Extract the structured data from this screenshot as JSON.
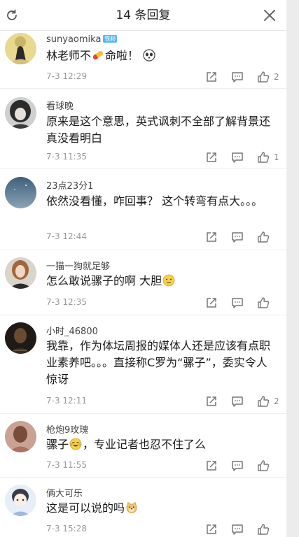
{
  "header": {
    "title": "14 条回复"
  },
  "comments": [
    {
      "user": "sunyaomika",
      "badge": "铁粉",
      "text_a": "林老师不",
      "text_b": "命啦！",
      "time": "7-3 12:29",
      "likes": "2"
    },
    {
      "user": "看球晚",
      "text": "原来是这个意思，英式讽刺不全部了解背景还真没看明白",
      "time": "7-3 11:35",
      "likes": "1"
    },
    {
      "user": "23点23分1",
      "text": "依然没看懂，咋回事？ 这个转弯有点大。。。",
      "time": "7-3 12:44",
      "likes": ""
    },
    {
      "user": "一猫一狗就足够",
      "text": "怎么敢说骡子的啊 大胆",
      "time": "7-3 12:35",
      "likes": ""
    },
    {
      "user": "小时_46800",
      "text": "我靠，作为体坛周报的媒体人还是应该有点职业素养吧。。。直接称C罗为“骡子”，委实令人惊讶",
      "time": "7-3 12:11",
      "likes": "2"
    },
    {
      "user": "枪炮9玫瑰",
      "text_a": "骡子",
      "text_b": "，专业记者也忍不住了么",
      "time": "7-3 11:55",
      "likes": ""
    },
    {
      "user": "俩大可乐",
      "text": "这是可以说的吗",
      "time": "7-3 15:28",
      "likes": ""
    }
  ],
  "colors": {
    "badge": "#59b5f0",
    "pill_red": "#e8413a",
    "pill_yellow": "#f5c33b"
  },
  "icons": [
    "refresh-icon",
    "close-icon",
    "share-icon",
    "comment-icon",
    "thumbs-up-icon",
    "pill-icon",
    "panda-icon",
    "thinking-face-icon",
    "laughing-tears-icon",
    "doge-icon"
  ]
}
